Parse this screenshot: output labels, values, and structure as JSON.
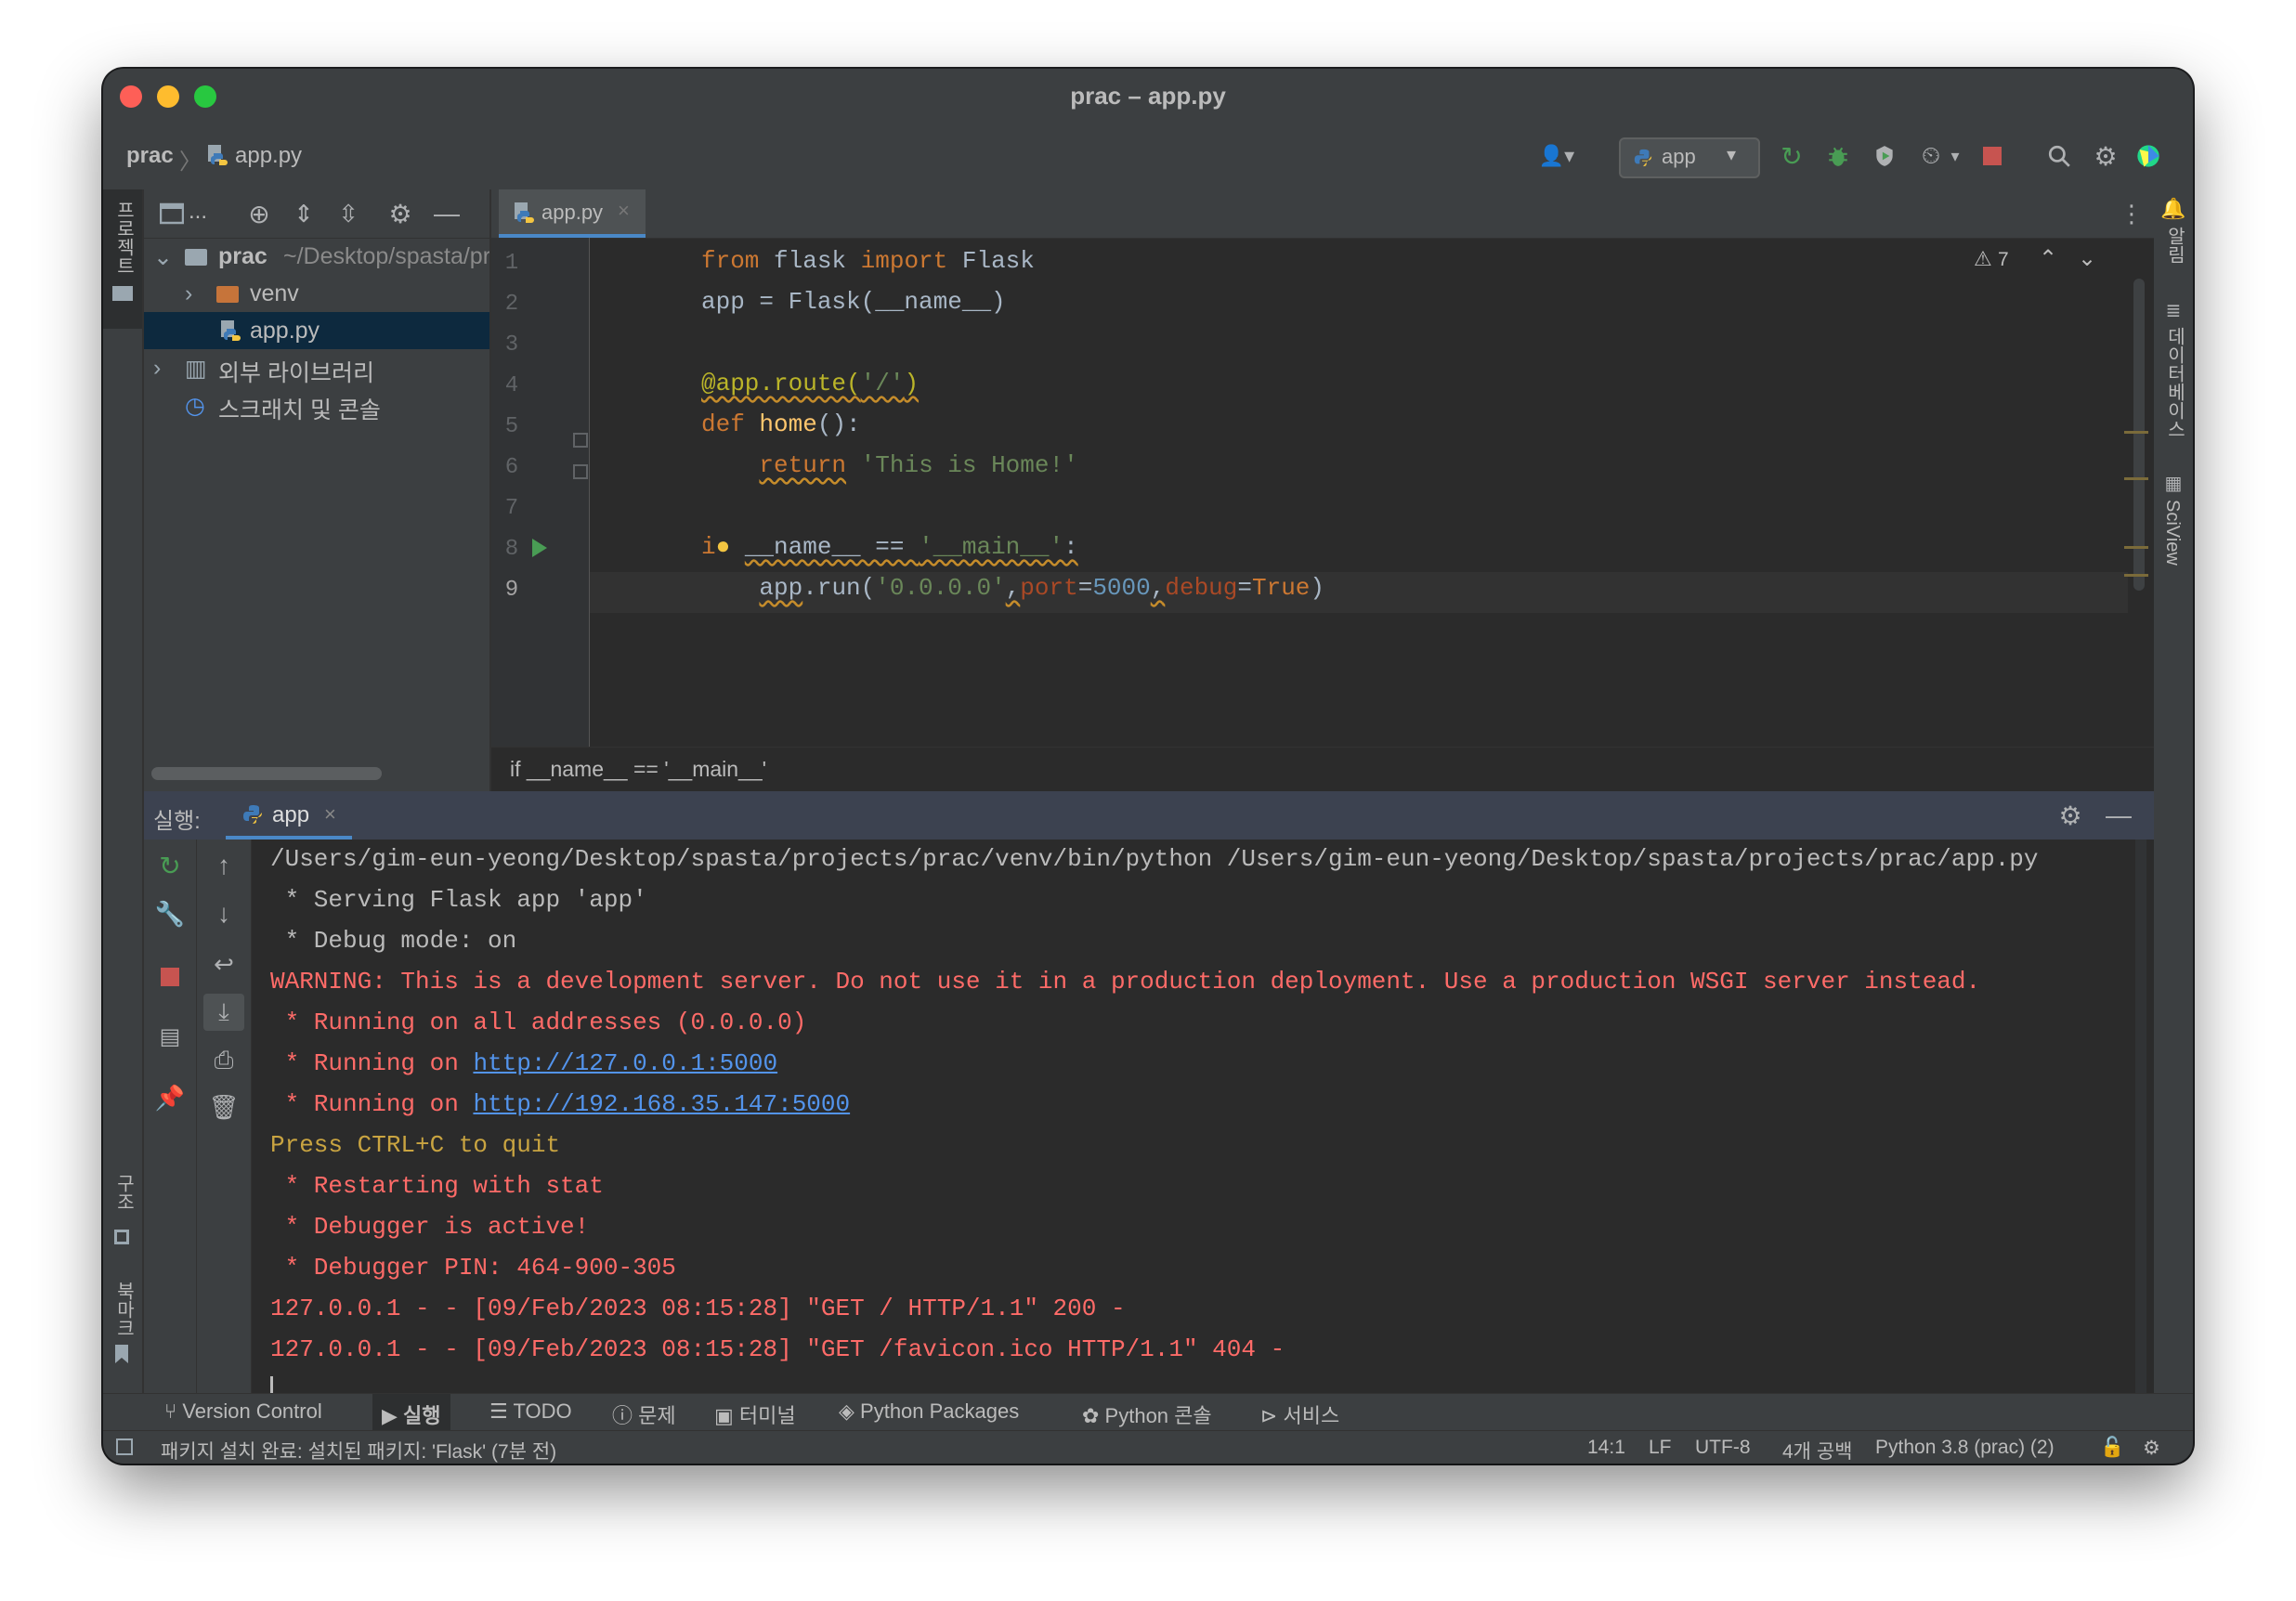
{
  "window": {
    "title": "prac – app.py"
  },
  "navbar": {
    "project": "prac",
    "file": "app.py",
    "run_config": "app"
  },
  "left_stripe": {
    "project_tab": "프로젝트",
    "structure_tab": "구조",
    "bookmarks_tab": "북마크"
  },
  "right_stripe": {
    "notifications_tab": "알림",
    "database_tab": "데이터베이스",
    "sciview_tab": "SciView"
  },
  "project_panel": {
    "toolbar_label": "...",
    "tree": [
      {
        "label": "prac",
        "hint": "~/Desktop/spasta/projects/prac"
      },
      {
        "label": "venv"
      },
      {
        "label": "app.py"
      },
      {
        "label": "외부 라이브러리"
      },
      {
        "label": "스크래치 및 콘솔"
      }
    ]
  },
  "editor": {
    "tab_label": "app.py",
    "warning_count": "7",
    "line_numbers": [
      "1",
      "2",
      "3",
      "4",
      "5",
      "6",
      "7",
      "8",
      "9"
    ],
    "breadcrumb": "if __name__ == '__main__'"
  },
  "run_panel": {
    "label": "실행:",
    "tab": "app",
    "lines": [
      "/Users/gim-eun-yeong/Desktop/spasta/projects/prac/venv/bin/python /Users/gim-eun-yeong/Desktop/spasta/projects/prac/app.py",
      " * Serving Flask app 'app'",
      " * Debug mode: on",
      "WARNING: This is a development server. Do not use it in a production deployment. Use a production WSGI server instead.",
      " * Running on all addresses (0.0.0.0)",
      " * Running on ",
      "http://127.0.0.1:5000",
      " * Running on ",
      "http://192.168.35.147:5000",
      "Press CTRL+C to quit",
      " * Restarting with stat",
      " * Debugger is active!",
      " * Debugger PIN: 464-900-305",
      "127.0.0.1 - - [09/Feb/2023 08:15:28] \"GET / HTTP/1.1\" 200 -",
      "127.0.0.1 - - [09/Feb/2023 08:15:28] \"GET /favicon.ico HTTP/1.1\" 404 -"
    ]
  },
  "tool_tabs": [
    "Version Control",
    "실행",
    "TODO",
    "문제",
    "터미널",
    "Python Packages",
    "Python 콘솔",
    "서비스"
  ],
  "status": {
    "message": "패키지 설치 완료: 설치된 패키지: 'Flask' (7분 전)",
    "position": "14:1",
    "line_sep": "LF",
    "encoding": "UTF-8",
    "indent": "4개 공백",
    "interpreter": "Python 3.8 (prac) (2)"
  },
  "colors": {
    "accent": "#4a88c7",
    "run_green": "#499c54",
    "stop_red": "#c75450",
    "warning_red": "#ff6b68"
  }
}
